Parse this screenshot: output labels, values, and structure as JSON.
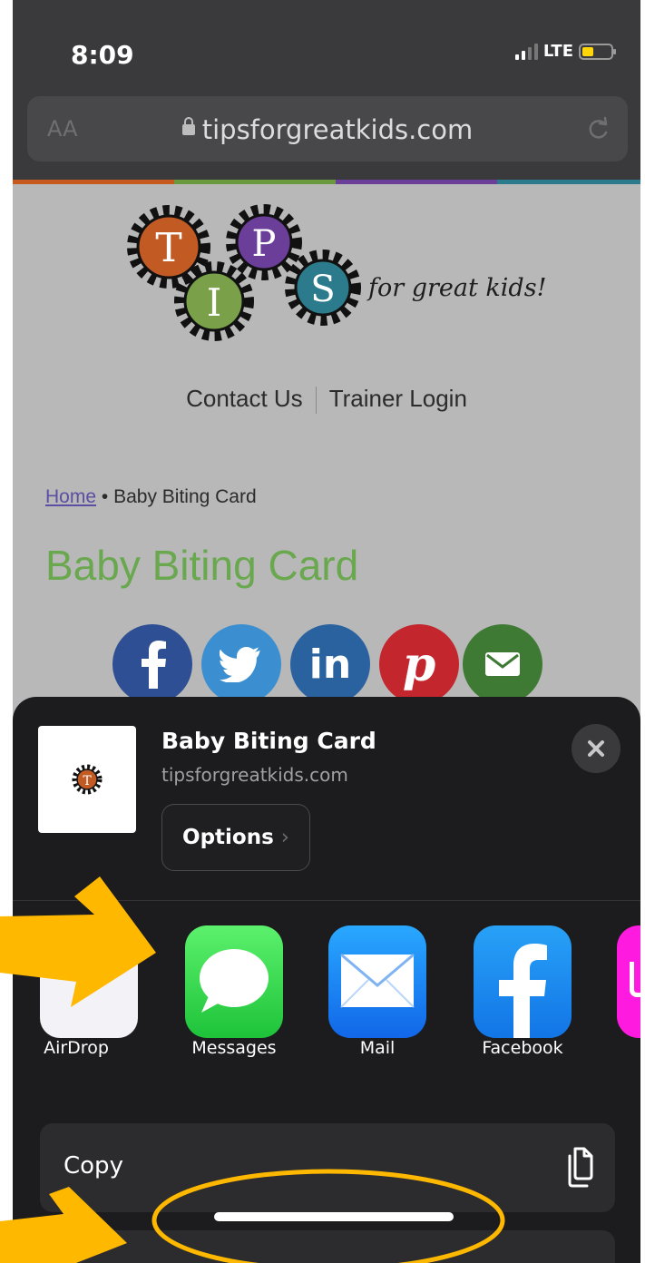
{
  "status_bar": {
    "time": "8:09",
    "network": "LTE",
    "battery_color": "#ffd60a"
  },
  "browser": {
    "text_size_button": "AA",
    "url": "tipsforgreatkids.com"
  },
  "site": {
    "logo": {
      "letters": [
        "T",
        "I",
        "P",
        "S"
      ],
      "tagline": "for great kids!"
    },
    "nav": {
      "contact": "Contact Us",
      "trainer_login": "Trainer Login"
    },
    "breadcrumb": {
      "home": "Home",
      "separator": "•",
      "current": "Baby Biting Card"
    },
    "title": "Baby Biting Card",
    "social_icons": [
      "facebook-icon",
      "twitter-icon",
      "linkedin-icon",
      "pinterest-icon",
      "email-icon"
    ]
  },
  "share_sheet": {
    "title": "Baby Biting Card",
    "subtitle": "tipsforgreatkids.com",
    "options_label": "Options",
    "apps": [
      {
        "label": "AirDrop",
        "icon": "airdrop-icon"
      },
      {
        "label": "Messages",
        "icon": "messages-icon"
      },
      {
        "label": "Mail",
        "icon": "mail-icon"
      },
      {
        "label": "Facebook",
        "icon": "facebook-icon"
      }
    ],
    "actions": [
      {
        "label": "Copy",
        "icon": "copy-icon"
      }
    ]
  },
  "annotations": {
    "arrow_color": "#ffb800",
    "highlight_color": "#ffb800"
  }
}
